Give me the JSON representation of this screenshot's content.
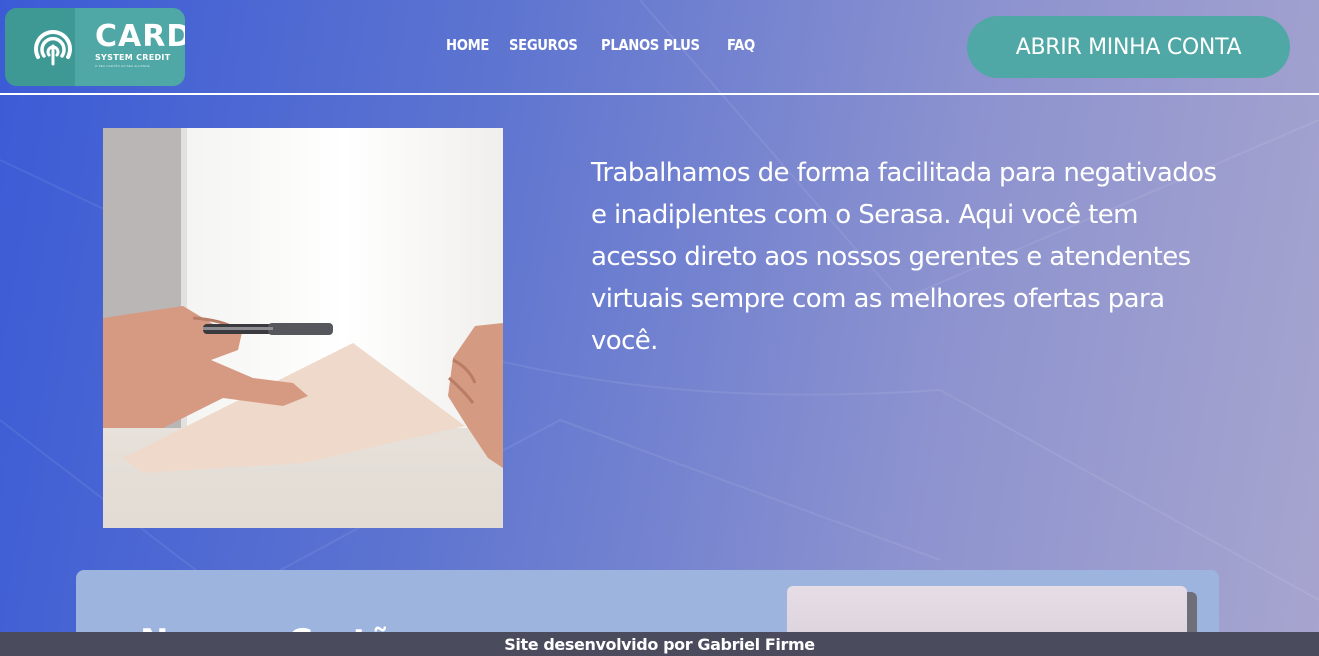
{
  "header": {
    "logo": {
      "brand": "CARD",
      "subtitle": "SYSTEM CREDIT",
      "tagline": "O SEU CARTÃO AO SEU ALCANCE",
      "icon": "fingerprint-icon"
    },
    "nav": [
      "HOME",
      "SEGUROS",
      "PLANOS PLUS",
      "FAQ"
    ],
    "cta_label": "ABRIR MINHA CONTA"
  },
  "hero": {
    "image": "handshake-contract-photo",
    "text": "Trabalhamos de forma facilitada para negativados e inadiplentes com o Serasa. Aqui você tem acesso direto aos nossos gerentes e atendentes virtuais sempre com as melhores ofertas para você."
  },
  "card": {
    "heading": "Nossos Cartões"
  },
  "footer": {
    "credit": "Site desenvolvido por Gabriel Firme"
  },
  "colors": {
    "accent": "#4fa8a5",
    "gradient_start": "#3b5bd6",
    "gradient_end": "#a7a5cf",
    "card_background": "#9cb4de",
    "footer_background": "#4a4c5e"
  }
}
